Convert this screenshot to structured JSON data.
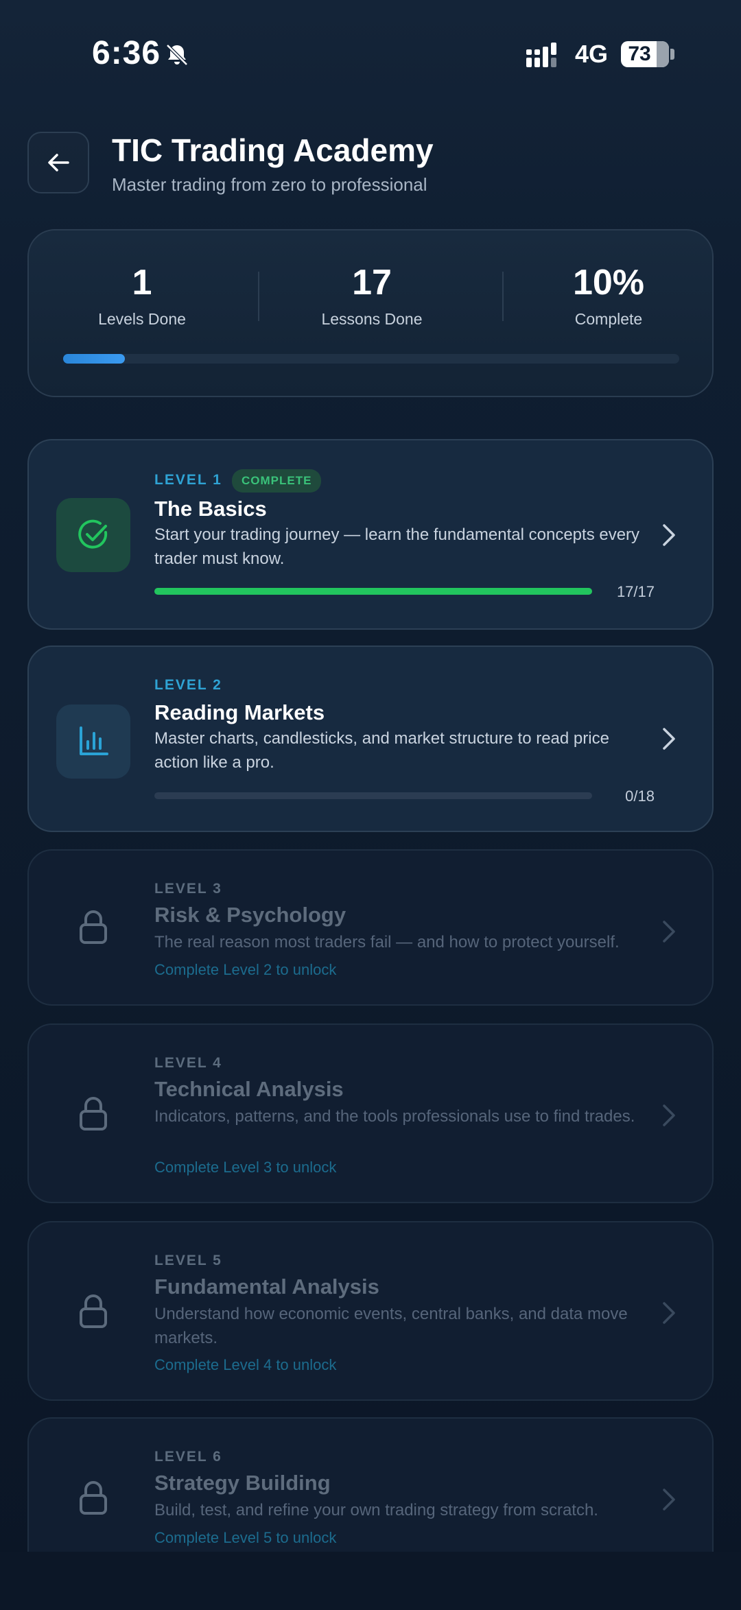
{
  "status": {
    "time": "6:36",
    "network": "4G",
    "battery": "73"
  },
  "header": {
    "title": "TIC Trading Academy",
    "subtitle": "Master trading from zero to professional"
  },
  "stats": {
    "levels_done": "1",
    "levels_label": "Levels Done",
    "lessons_done": "17",
    "lessons_label": "Lessons Done",
    "complete": "10%",
    "complete_label": "Complete",
    "progress_fraction": 0.1
  },
  "levels": [
    {
      "tag": "LEVEL 1",
      "badge": "COMPLETE",
      "title": "The Basics",
      "desc": "Start your trading journey — learn the fundamental concepts every trader must know.",
      "count": "17/17",
      "progress": 1.0,
      "state": "complete",
      "icon": "check-circle-icon"
    },
    {
      "tag": "LEVEL 2",
      "title": "Reading Markets",
      "desc": "Master charts, candlesticks, and market structure to read price action like a pro.",
      "count": "0/18",
      "progress": 0.0,
      "state": "active",
      "icon": "bar-chart-icon"
    },
    {
      "tag": "LEVEL 3",
      "title": "Risk & Psychology",
      "desc": "The real reason most traders fail — and how to protect yourself.",
      "hint": "Complete Level 2 to unlock",
      "state": "locked",
      "icon": "lock-icon"
    },
    {
      "tag": "LEVEL 4",
      "title": "Technical Analysis",
      "desc": "Indicators, patterns, and the tools professionals use to find trades.",
      "hint": "Complete Level 3 to unlock",
      "state": "locked",
      "icon": "lock-icon"
    },
    {
      "tag": "LEVEL 5",
      "title": "Fundamental Analysis",
      "desc": "Understand how economic events, central banks, and data move markets.",
      "hint": "Complete Level 4 to unlock",
      "state": "locked",
      "icon": "lock-icon"
    },
    {
      "tag": "LEVEL 6",
      "title": "Strategy Building",
      "desc": "Build, test, and refine your own trading strategy from scratch.",
      "hint": "Complete Level 5 to unlock",
      "state": "locked",
      "icon": "lock-icon"
    }
  ],
  "colors": {
    "accent": "#2fa3d4",
    "success": "#22c55e",
    "background": "#0f1e31"
  }
}
